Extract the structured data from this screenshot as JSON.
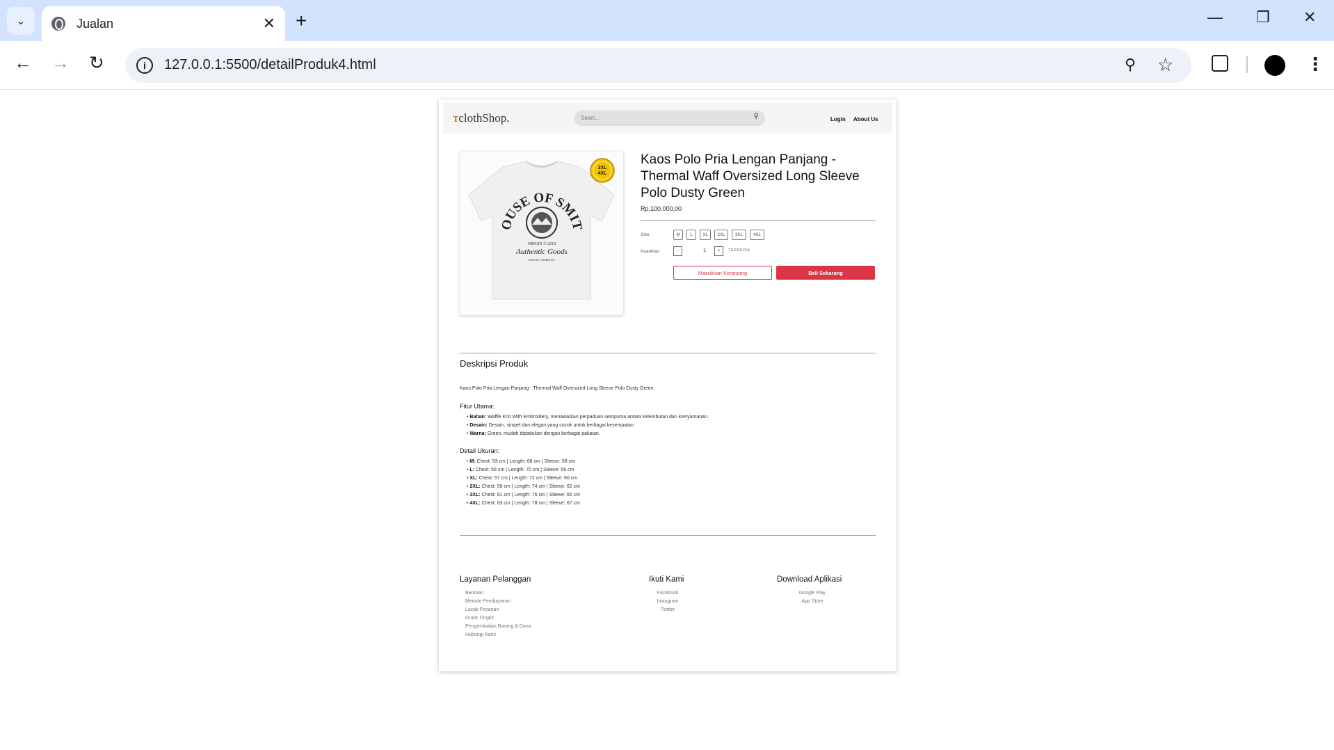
{
  "browser": {
    "tab_title": "Jualan",
    "url": "127.0.0.1:5500/detailProduk4.html"
  },
  "site": {
    "logo": "clothShop.",
    "search_placeholder": "Searc...",
    "nav": {
      "login": "Login",
      "about": "About Us"
    }
  },
  "product": {
    "title": "Kaos Polo Pria Lengan Panjang - Thermal Waff Oversized Long Sleeve Polo Dusty Green",
    "price": "Rp.100.000,00",
    "image_print": {
      "arc_text": "HOUSE OF SMITH",
      "origin": "ORIGIN © 2010",
      "script": "Authentic Goods",
      "company": "HOUSE COMPANY"
    },
    "badge": {
      "line1": "3XL",
      "line2": "4XL"
    },
    "size_label": "Size",
    "sizes": [
      "M",
      "L",
      "XL",
      "2XL",
      "3XL",
      "4XL"
    ],
    "qty_label": "Kuantitas",
    "qty_minus": "-",
    "qty_value": "1",
    "qty_plus": "+",
    "stock": "TERSEDIA",
    "btn_cart": "Masukkan Keranjang",
    "btn_buy": "Beli Sekarang"
  },
  "description": {
    "heading": "Deskripsi Produk",
    "intro": "Kaos Polo Pria Lengan Panjang - Thermal Waff Oversized Long Sleeve Polo Dusty Green",
    "features_heading": "Fitur Utama:",
    "features": [
      {
        "key": "Bahan:",
        "text": " Waffle Knit With Embroidery, menawarkan perpaduan sempurna antara kelembutan dan Kenyamanan."
      },
      {
        "key": "Desain:",
        "text": " Desain, simpel dan elegan yang cocok untuk berbagai kesempatan."
      },
      {
        "key": "Warna:",
        "text": " Green, mudah dipadukan dengan berbagai pakaian."
      }
    ],
    "sizes_heading": "Detail Ukuran:",
    "size_details": [
      {
        "key": "M:",
        "text": " Chest: 53 cm | Length: 68 cm | Sleeve: 58 cm"
      },
      {
        "key": "L:",
        "text": " Chest: 55 cm | Length: 70 cm | Sleeve: 59 cm"
      },
      {
        "key": "XL:",
        "text": " Chest: 57 cm | Length: 72 cm | Sleeve: 60 cm"
      },
      {
        "key": "2XL:",
        "text": " Chest: 59 cm | Length: 74 cm | Sleeve: 62 cm"
      },
      {
        "key": "3XL:",
        "text": " Chest: 61 cm | Length: 76 cm | Sleeve: 65 cm"
      },
      {
        "key": "4XL:",
        "text": " Chest: 63 cm | Length: 78 cm | Sleeve: 67 cm"
      }
    ]
  },
  "footer": {
    "service_heading": "Layanan Pelanggan",
    "service_links": [
      "Bantuan",
      "Metode Pembayaran",
      "Lacak Pesanan",
      "Gratis Ongkir",
      "Pengembalian Barang & Dana",
      "Hubungi Kami"
    ],
    "follow_heading": "Ikuti Kami",
    "follow_links": [
      "Facebook",
      "Instagram",
      "Twitter"
    ],
    "app_heading": "Download Aplikasi",
    "app_links": [
      "Google Play",
      "App Store"
    ]
  },
  "colors": {
    "accent": "#dc3545",
    "tabbar": "#d3e3fd",
    "badge": "#f2c200"
  }
}
